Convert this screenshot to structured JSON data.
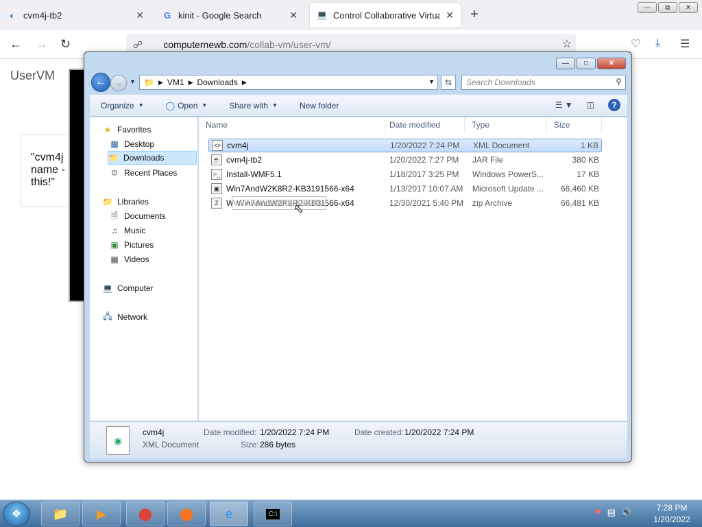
{
  "browser": {
    "tabs": [
      {
        "label": "cvm4j-tb2",
        "icon": "edge-icon"
      },
      {
        "label": "kinit - Google Search",
        "icon": "google-icon"
      },
      {
        "label": "Control Collaborative Virtual M",
        "icon": "collabvm-icon"
      }
    ],
    "url_host": "computernewb.com",
    "url_path": "/collab-vm/user-vm/"
  },
  "page": {
    "title": "UserVM",
    "quote_line1": "\"cvm4j",
    "quote_line2": "name -",
    "quote_line3": "this!\""
  },
  "explorer": {
    "breadcrumb": [
      "VM1",
      "Downloads"
    ],
    "search_placeholder": "Search Downloads",
    "toolbar": {
      "organize": "Organize",
      "open": "Open",
      "share_with": "Share with",
      "new_folder": "New folder"
    },
    "nav": {
      "favorites": "Favorites",
      "desktop": "Desktop",
      "downloads": "Downloads",
      "recent": "Recent Places",
      "libraries": "Libraries",
      "documents": "Documents",
      "music": "Music",
      "pictures": "Pictures",
      "videos": "Videos",
      "computer": "Computer",
      "network": "Network"
    },
    "columns": {
      "name": "Name",
      "date": "Date modified",
      "type": "Type",
      "size": "Size"
    },
    "files": [
      {
        "name": "cvm4j",
        "date": "1/20/2022 7:24 PM",
        "type": "XML Document",
        "size": "1 KB"
      },
      {
        "name": "cvm4j-tb2",
        "date": "1/20/2022 7:27 PM",
        "type": "JAR File",
        "size": "380 KB"
      },
      {
        "name": "Install-WMF5.1",
        "date": "1/18/2017 3:25 PM",
        "type": "Windows PowerS...",
        "size": "17 KB"
      },
      {
        "name": "Win7AndW2K8R2-KB3191566-x64",
        "date": "1/13/2017 10:07 AM",
        "type": "Microsoft Update ...",
        "size": "66,460 KB"
      },
      {
        "name": "Win7AndW2K8R2-KB3191566-x64",
        "date": "12/30/2021 5:40 PM",
        "type": "zip Archive",
        "size": "66,481 KB"
      }
    ],
    "drag_ghost": "Win7AndW2K8R2-KB3191566-x64",
    "details": {
      "name": "cvm4j",
      "type": "XML Document",
      "date_modified_label": "Date modified:",
      "date_modified": "1/20/2022 7:24 PM",
      "date_created_label": "Date created:",
      "date_created": "1/20/2022 7:24 PM",
      "size_label": "Size:",
      "size": "286 bytes"
    }
  },
  "taskbar": {
    "time": "7:28 PM",
    "date": "1/20/2022"
  }
}
